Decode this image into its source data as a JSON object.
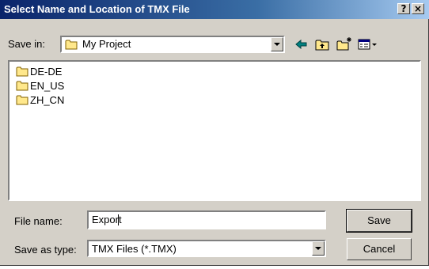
{
  "dialog": {
    "title": "Select Name and Location of TMX File",
    "help_button": "?",
    "close_button": "×"
  },
  "save_in": {
    "label": "Save in:",
    "value": "My Project"
  },
  "toolbar": {
    "icons": [
      "back-icon",
      "up-folder-icon",
      "new-folder-icon",
      "view-menu-icon"
    ]
  },
  "file_list": {
    "items": [
      {
        "name": "DE-DE",
        "icon": "folder-icon"
      },
      {
        "name": "EN_US",
        "icon": "folder-icon"
      },
      {
        "name": "ZH_CN",
        "icon": "folder-icon"
      }
    ]
  },
  "file_name": {
    "label": "File name:",
    "value": "Export"
  },
  "save_as_type": {
    "label": "Save as type:",
    "value": "TMX Files (*.TMX)"
  },
  "buttons": {
    "save": "Save",
    "cancel": "Cancel"
  },
  "colors": {
    "titlebar_start": "#0a246a",
    "titlebar_end": "#a6caf0",
    "face": "#d4d0c8",
    "folder": "#ffe88c"
  }
}
